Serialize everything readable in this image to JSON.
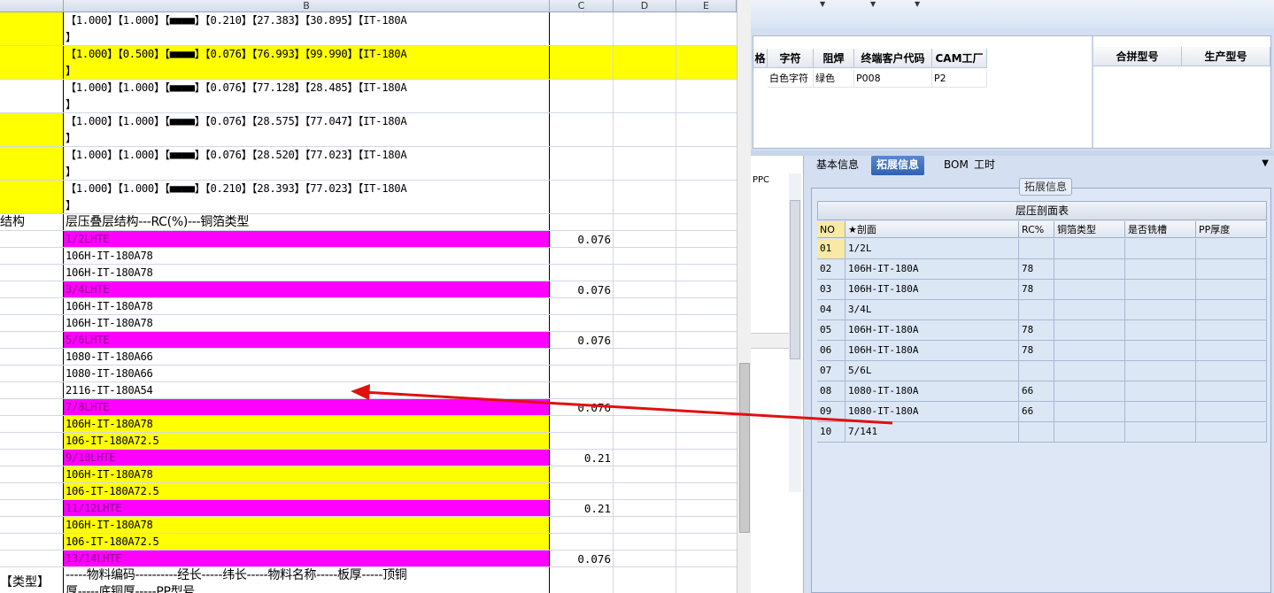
{
  "sheet": {
    "columns": [
      "B",
      "C",
      "D",
      "E"
    ],
    "rows": [
      {
        "a": "",
        "b": "【1.000】【1.000】【■■■■】【0.210】【27.383】【30.895】【IT-180A\n】",
        "c": "",
        "a_fill": "yellow",
        "b_fill": "white",
        "h": 38
      },
      {
        "a": "",
        "b": "【1.000】【0.500】【■■■■】【0.076】【76.993】【99.990】【IT-180A\n】",
        "c": "",
        "a_fill": "yellow",
        "b_fill": "yellow",
        "full_yellow": true,
        "h": 38
      },
      {
        "a": "",
        "b": "【1.000】【1.000】【■■■■】【0.076】【77.128】【28.485】【IT-180A\n】",
        "c": "",
        "a_fill": "white",
        "b_fill": "white",
        "h": 38
      },
      {
        "a": "",
        "b": "【1.000】【1.000】【■■■■】【0.076】【28.575】【77.047】【IT-180A\n】",
        "c": "",
        "a_fill": "yellow",
        "b_fill": "white",
        "h": 38
      },
      {
        "a": "",
        "b": "【1.000】【1.000】【■■■■】【0.076】【28.520】【77.023】【IT-180A\n】",
        "c": "",
        "a_fill": "yellow",
        "b_fill": "white",
        "h": 38
      },
      {
        "a": "",
        "b": "【1.000】【1.000】【■■■■】【0.210】【28.393】【77.023】【IT-180A\n】",
        "c": "",
        "a_fill": "yellow",
        "b_fill": "white",
        "h": 38
      },
      {
        "a": "结构",
        "b": "层压叠层结构---RC(%)---铜箔类型",
        "c": "",
        "a_fill": "white",
        "b_fill": "white",
        "h": 19
      },
      {
        "a": "",
        "b": "1/2LHTE",
        "c": "0.076",
        "a_fill": "white",
        "b_fill": "magenta",
        "h": 19
      },
      {
        "a": "",
        "b": "106H-IT-180A78",
        "c": "",
        "a_fill": "white",
        "b_fill": "white",
        "h": 19
      },
      {
        "a": "",
        "b": "106H-IT-180A78",
        "c": "",
        "a_fill": "white",
        "b_fill": "white",
        "h": 19
      },
      {
        "a": "",
        "b": "3/4LHTE",
        "c": "0.076",
        "a_fill": "white",
        "b_fill": "magenta",
        "h": 19
      },
      {
        "a": "",
        "b": "106H-IT-180A78",
        "c": "",
        "a_fill": "white",
        "b_fill": "white",
        "h": 19
      },
      {
        "a": "",
        "b": "106H-IT-180A78",
        "c": "",
        "a_fill": "white",
        "b_fill": "white",
        "h": 19
      },
      {
        "a": "",
        "b": "5/6LHTE",
        "c": "0.076",
        "a_fill": "white",
        "b_fill": "magenta",
        "h": 19
      },
      {
        "a": "",
        "b": "1080-IT-180A66",
        "c": "",
        "a_fill": "white",
        "b_fill": "white",
        "h": 19
      },
      {
        "a": "",
        "b": "1080-IT-180A66",
        "c": "",
        "a_fill": "white",
        "b_fill": "white",
        "h": 19
      },
      {
        "a": "",
        "b": "2116-IT-180A54",
        "c": "",
        "a_fill": "white",
        "b_fill": "white",
        "h": 19
      },
      {
        "a": "",
        "b": "7/8LHTE",
        "c": "0.076",
        "a_fill": "white",
        "b_fill": "magenta",
        "h": 19
      },
      {
        "a": "",
        "b": "106H-IT-180A78",
        "c": "",
        "a_fill": "white",
        "b_fill": "yellow",
        "h": 19
      },
      {
        "a": "",
        "b": "106-IT-180A72.5",
        "c": "",
        "a_fill": "white",
        "b_fill": "yellow",
        "h": 19
      },
      {
        "a": "",
        "b": "9/10LHTE",
        "c": "0.21",
        "a_fill": "white",
        "b_fill": "magenta",
        "h": 19
      },
      {
        "a": "",
        "b": "106H-IT-180A78",
        "c": "",
        "a_fill": "white",
        "b_fill": "yellow",
        "h": 19
      },
      {
        "a": "",
        "b": "106-IT-180A72.5",
        "c": "",
        "a_fill": "white",
        "b_fill": "yellow",
        "h": 19
      },
      {
        "a": "",
        "b": "11/12LHTE",
        "c": "0.21",
        "a_fill": "white",
        "b_fill": "magenta",
        "h": 19
      },
      {
        "a": "",
        "b": "106H-IT-180A78",
        "c": "",
        "a_fill": "white",
        "b_fill": "yellow",
        "h": 19
      },
      {
        "a": "",
        "b": "106-IT-180A72.5",
        "c": "",
        "a_fill": "white",
        "b_fill": "yellow",
        "h": 19
      },
      {
        "a": "",
        "b": "13/14LHTE",
        "c": "0.076",
        "a_fill": "white",
        "b_fill": "magenta",
        "h": 19
      },
      {
        "a": "【类型】",
        "b": "-----物料编码----------经长-----纬长-----物料名称-----板厚-----顶铜\n厚-----底铜厚-----PP型号",
        "c": "",
        "a_fill": "white",
        "b_fill": "white",
        "h": 40
      }
    ]
  },
  "top_table": {
    "headers": [
      "格",
      "字符",
      "阻焊",
      "终端客户代码",
      "CAM工厂"
    ],
    "row": [
      "",
      "白色字符",
      "绿色",
      "P008",
      "P2"
    ],
    "right_headers": [
      "合拼型号",
      "生产型号"
    ]
  },
  "left_pane": {
    "label": "PPC"
  },
  "tabs": [
    "基本信息",
    "拓展信息",
    "BOM",
    "工时"
  ],
  "group_title": "拓展信息",
  "laminate_table": {
    "title": "层压剖面表",
    "headers": [
      "NO",
      "★剖面",
      "RC%",
      "铜箔类型",
      "是否铣槽",
      "PP厚度"
    ],
    "rows": [
      [
        "01",
        "1/2L",
        ""
      ],
      [
        "02",
        "106H-IT-180A",
        "78"
      ],
      [
        "03",
        "106H-IT-180A",
        "78"
      ],
      [
        "04",
        "3/4L",
        ""
      ],
      [
        "05",
        "106H-IT-180A",
        "78"
      ],
      [
        "06",
        "106H-IT-180A",
        "78"
      ],
      [
        "07",
        "5/6L",
        ""
      ],
      [
        "08",
        "1080-IT-180A",
        "66"
      ],
      [
        "09",
        "1080-IT-180A",
        "66"
      ],
      [
        "10",
        "7/141",
        ""
      ]
    ]
  },
  "colors": {
    "yellow": "#ffff00",
    "magenta": "#ff00ff",
    "arrow": "#e01010",
    "active_tab": "#2e62b4"
  }
}
